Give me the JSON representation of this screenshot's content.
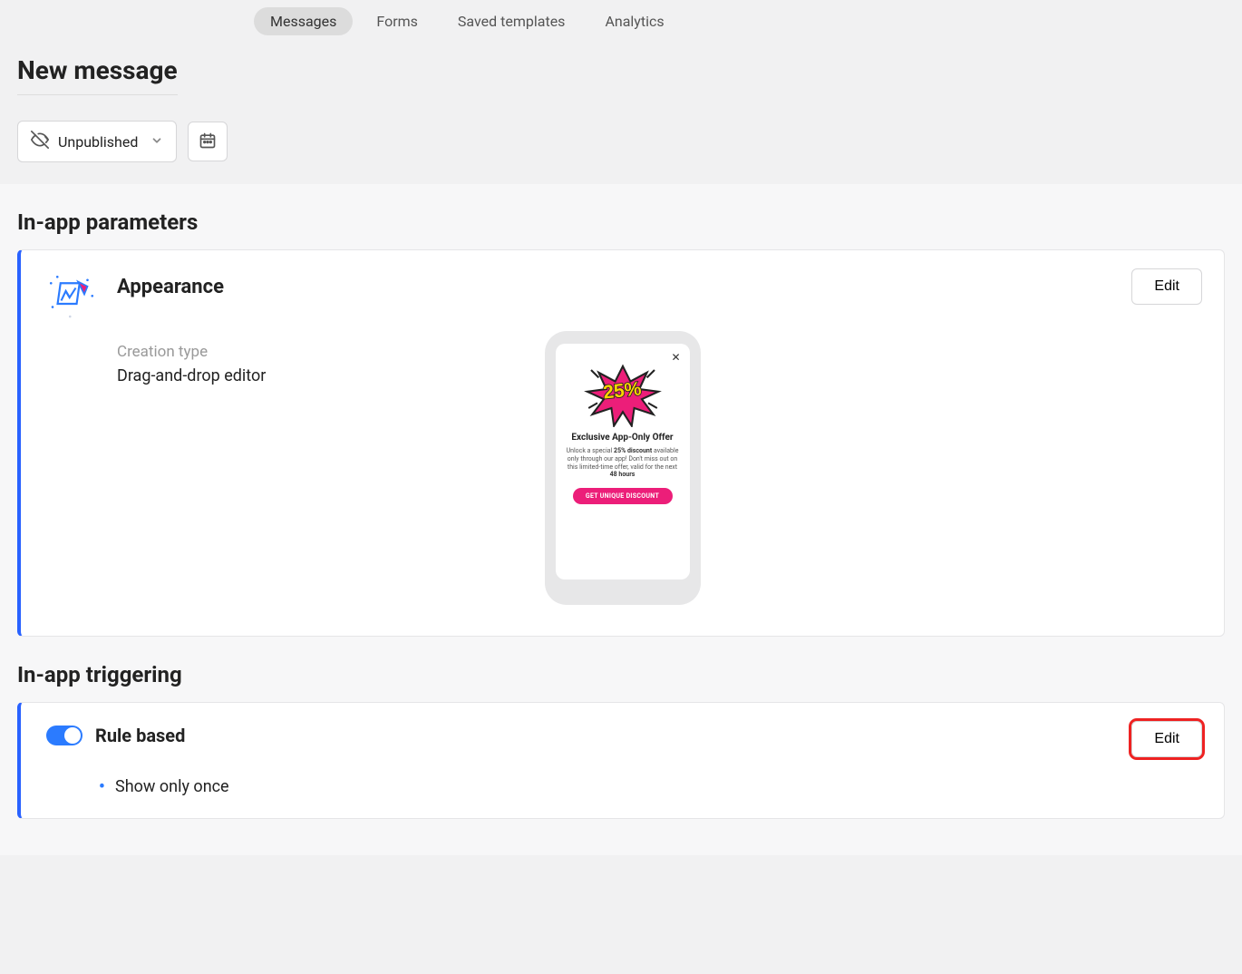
{
  "tabs": {
    "items": [
      {
        "label": "Messages",
        "active": true
      },
      {
        "label": "Forms",
        "active": false
      },
      {
        "label": "Saved templates",
        "active": false
      },
      {
        "label": "Analytics",
        "active": false
      }
    ]
  },
  "page": {
    "title": "New message"
  },
  "status": {
    "label": "Unpublished"
  },
  "sections": {
    "params_title": "In-app parameters",
    "trigger_title": "In-app triggering"
  },
  "appearance": {
    "title": "Appearance",
    "edit_label": "Edit",
    "creation_type_label": "Creation type",
    "creation_type_value": "Drag-and-drop editor"
  },
  "preview": {
    "badge_text": "25%",
    "title": "Exclusive App-Only Offer",
    "body_pre": "Unlock a special ",
    "body_bold1": "25% discount",
    "body_mid": " available only through our app! Don't miss out on this limited-time offer, valid for the next ",
    "body_bold2": "48 hours",
    "cta": "GET UNIQUE DISCOUNT"
  },
  "rule": {
    "title": "Rule based",
    "edit_label": "Edit",
    "enabled": true,
    "items": [
      "Show only once"
    ]
  }
}
